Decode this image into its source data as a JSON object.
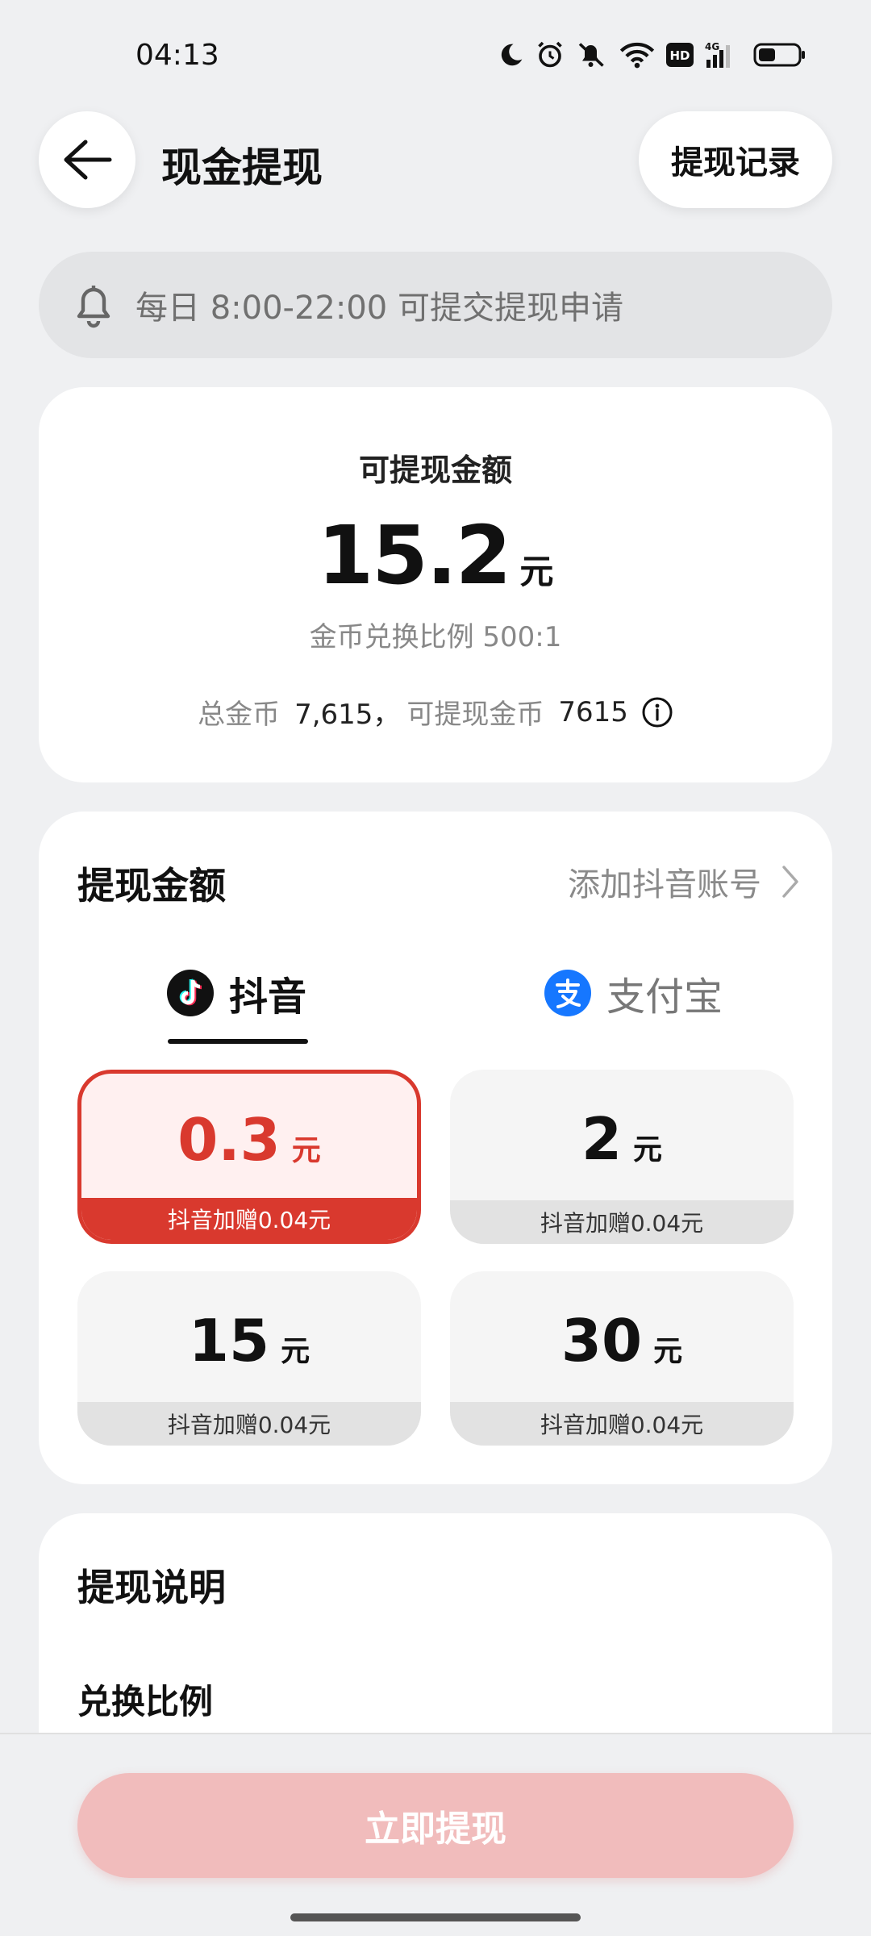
{
  "status": {
    "time": "04:13"
  },
  "header": {
    "title": "现金提现",
    "record_label": "提现记录"
  },
  "notice": {
    "text": "每日 8:00-22:00 可提交提现申请"
  },
  "balance": {
    "label": "可提现金额",
    "amount": "15.2",
    "unit": "元",
    "rate": "金币兑换比例 500:1",
    "total_label": "总金币",
    "total_value": "7,615，",
    "available_label": "可提现金币",
    "available_value": "7615"
  },
  "amount_section": {
    "title": "提现金额",
    "add_account": "添加抖音账号",
    "tabs": [
      {
        "label": "抖音",
        "selected": true
      },
      {
        "label": "支付宝",
        "selected": false
      }
    ],
    "options": [
      {
        "value": "0.3",
        "unit": "元",
        "bonus": "抖音加赠0.04元",
        "selected": true
      },
      {
        "value": "2",
        "unit": "元",
        "bonus": "抖音加赠0.04元",
        "selected": false
      },
      {
        "value": "15",
        "unit": "元",
        "bonus": "抖音加赠0.04元",
        "selected": false
      },
      {
        "value": "30",
        "unit": "元",
        "bonus": "抖音加赠0.04元",
        "selected": false
      }
    ]
  },
  "info_section": {
    "title": "提现说明",
    "subtitle": "兑换比例"
  },
  "action": {
    "withdraw_label": "立即提现"
  },
  "colors": {
    "accent": "#d9392e",
    "button_disabled": "#f1bcbc",
    "alipay": "#1677ff"
  }
}
